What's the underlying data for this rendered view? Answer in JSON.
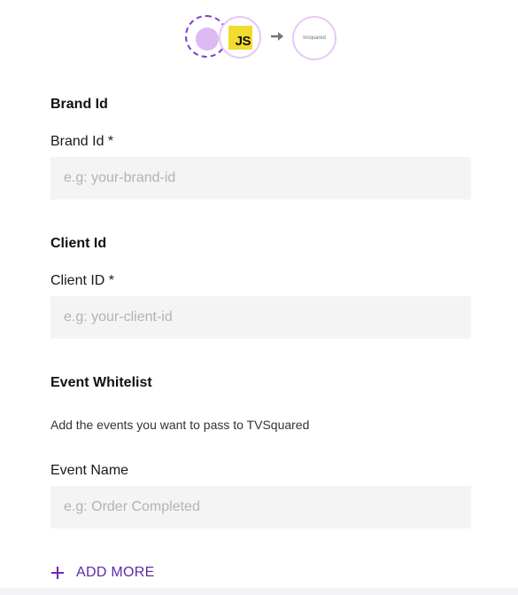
{
  "header": {
    "js_badge": "JS",
    "destination_logo": "tvsquared"
  },
  "sections": {
    "brand": {
      "heading": "Brand Id",
      "label": "Brand Id *",
      "placeholder": "e.g: your-brand-id",
      "value": ""
    },
    "client": {
      "heading": "Client Id",
      "label": "Client ID *",
      "placeholder": "e.g: your-client-id",
      "value": ""
    },
    "whitelist": {
      "heading": "Event Whitelist",
      "helper": "Add the events you want to pass to TVSquared",
      "label": "Event Name",
      "placeholder": "e.g: Order Completed",
      "value": "",
      "add_more_label": "ADD MORE"
    }
  },
  "colors": {
    "accent": "#6a2bb5",
    "input_background": "#f4f4f4",
    "js_yellow": "#f0db2e",
    "circle_border": "#e6c9f7"
  },
  "icons": {
    "source": "source-dashed-circle-icon",
    "arrow": "arrow-right-icon",
    "add": "plus-icon"
  }
}
